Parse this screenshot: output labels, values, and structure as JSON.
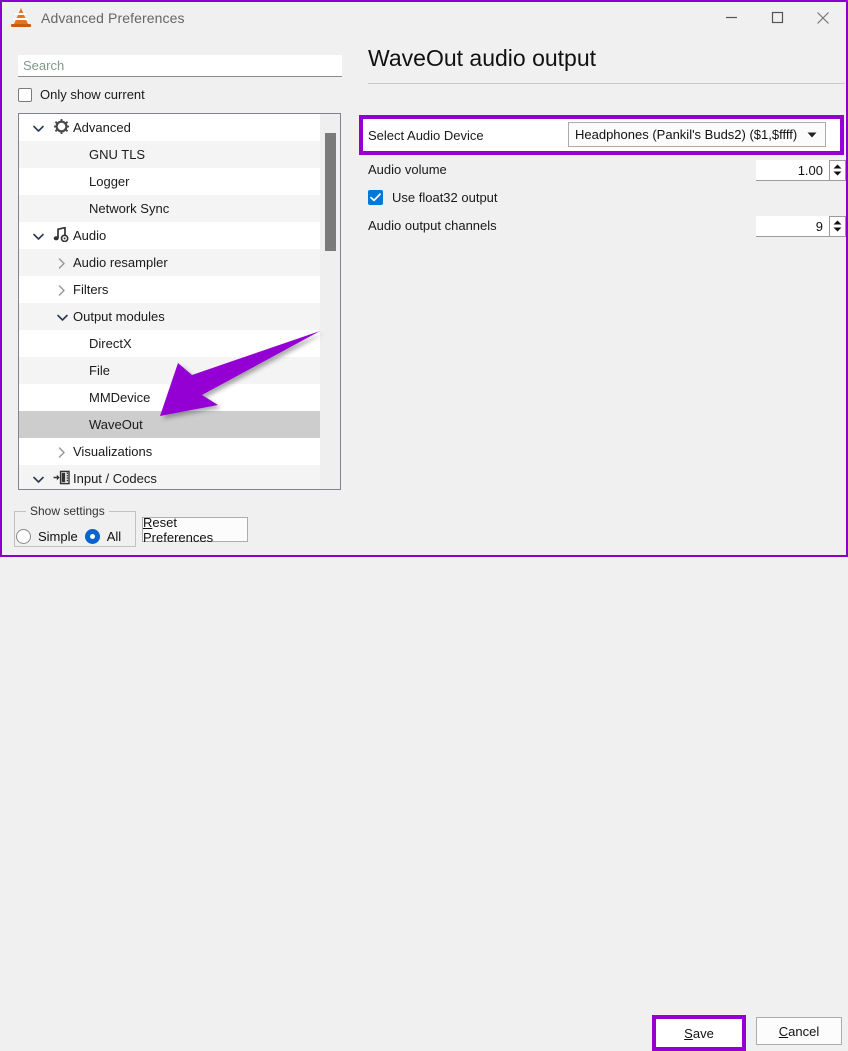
{
  "window": {
    "title": "Advanced Preferences",
    "icon": "vlc-cone-icon",
    "accent_purple": "#9400D3",
    "controls": [
      {
        "name": "minimize-button",
        "glyph": "minimize-icon"
      },
      {
        "name": "maximize-button",
        "glyph": "maximize-icon"
      },
      {
        "name": "close-button",
        "glyph": "close-icon"
      }
    ]
  },
  "sidebar": {
    "search": {
      "value": "",
      "placeholder": "Search"
    },
    "only_show_current": {
      "label": "Only show current",
      "checked": false
    },
    "tree": [
      {
        "label": "Advanced",
        "indent": 0,
        "twisty": "chevron-down",
        "icon": "gear-icon",
        "selected": false,
        "alt": false
      },
      {
        "label": "GNU TLS",
        "indent": 2,
        "twisty": "none",
        "icon": "none",
        "selected": false,
        "alt": true
      },
      {
        "label": "Logger",
        "indent": 2,
        "twisty": "none",
        "icon": "none",
        "selected": false,
        "alt": false
      },
      {
        "label": "Network Sync",
        "indent": 2,
        "twisty": "none",
        "icon": "none",
        "selected": false,
        "alt": true
      },
      {
        "label": "Audio",
        "indent": 0,
        "twisty": "chevron-down",
        "icon": "music-note-icon",
        "selected": false,
        "alt": false
      },
      {
        "label": "Audio resampler",
        "indent": 1,
        "twisty": "chevron-right",
        "icon": "none",
        "selected": false,
        "alt": true
      },
      {
        "label": "Filters",
        "indent": 1,
        "twisty": "chevron-right",
        "icon": "none",
        "selected": false,
        "alt": false
      },
      {
        "label": "Output modules",
        "indent": 1,
        "twisty": "chevron-down",
        "icon": "none",
        "selected": false,
        "alt": true
      },
      {
        "label": "DirectX",
        "indent": 2,
        "twisty": "none",
        "icon": "none",
        "selected": false,
        "alt": false
      },
      {
        "label": "File",
        "indent": 2,
        "twisty": "none",
        "icon": "none",
        "selected": false,
        "alt": true
      },
      {
        "label": "MMDevice",
        "indent": 2,
        "twisty": "none",
        "icon": "none",
        "selected": false,
        "alt": false
      },
      {
        "label": "WaveOut",
        "indent": 2,
        "twisty": "none",
        "icon": "none",
        "selected": true,
        "alt": true
      },
      {
        "label": "Visualizations",
        "indent": 1,
        "twisty": "chevron-right",
        "icon": "none",
        "selected": false,
        "alt": false
      },
      {
        "label": "Input / Codecs",
        "indent": 0,
        "twisty": "chevron-down",
        "icon": "codec-icon",
        "selected": false,
        "alt": true
      }
    ],
    "scrollbar": {
      "name": "tree-scrollbar"
    }
  },
  "main": {
    "title": "WaveOut audio output",
    "select_audio_device": {
      "label": "Select Audio Device",
      "value": "Headphones (Pankil's Buds2) ($1,$ffff)",
      "highlighted": true
    },
    "audio_volume": {
      "label": "Audio volume",
      "value": "1.00"
    },
    "use_float32": {
      "label": "Use float32 output",
      "checked": true,
      "color": "#0078D7"
    },
    "audio_output_channels": {
      "label": "Audio output channels",
      "value": "9"
    }
  },
  "footer": {
    "show_settings": {
      "group_label": "Show settings",
      "options": [
        {
          "label": "Simple",
          "selected": false
        },
        {
          "label": "All",
          "selected": true
        }
      ]
    },
    "reset_label": "Reset Preferences",
    "reset_mnemonic": "R",
    "save_label": "Save",
    "save_mnemonic": "S",
    "save_highlighted": true,
    "cancel_label": "Cancel",
    "cancel_mnemonic": "C"
  },
  "annotation": {
    "arrow_color": "#9400D3",
    "points_to": "WaveOut"
  }
}
